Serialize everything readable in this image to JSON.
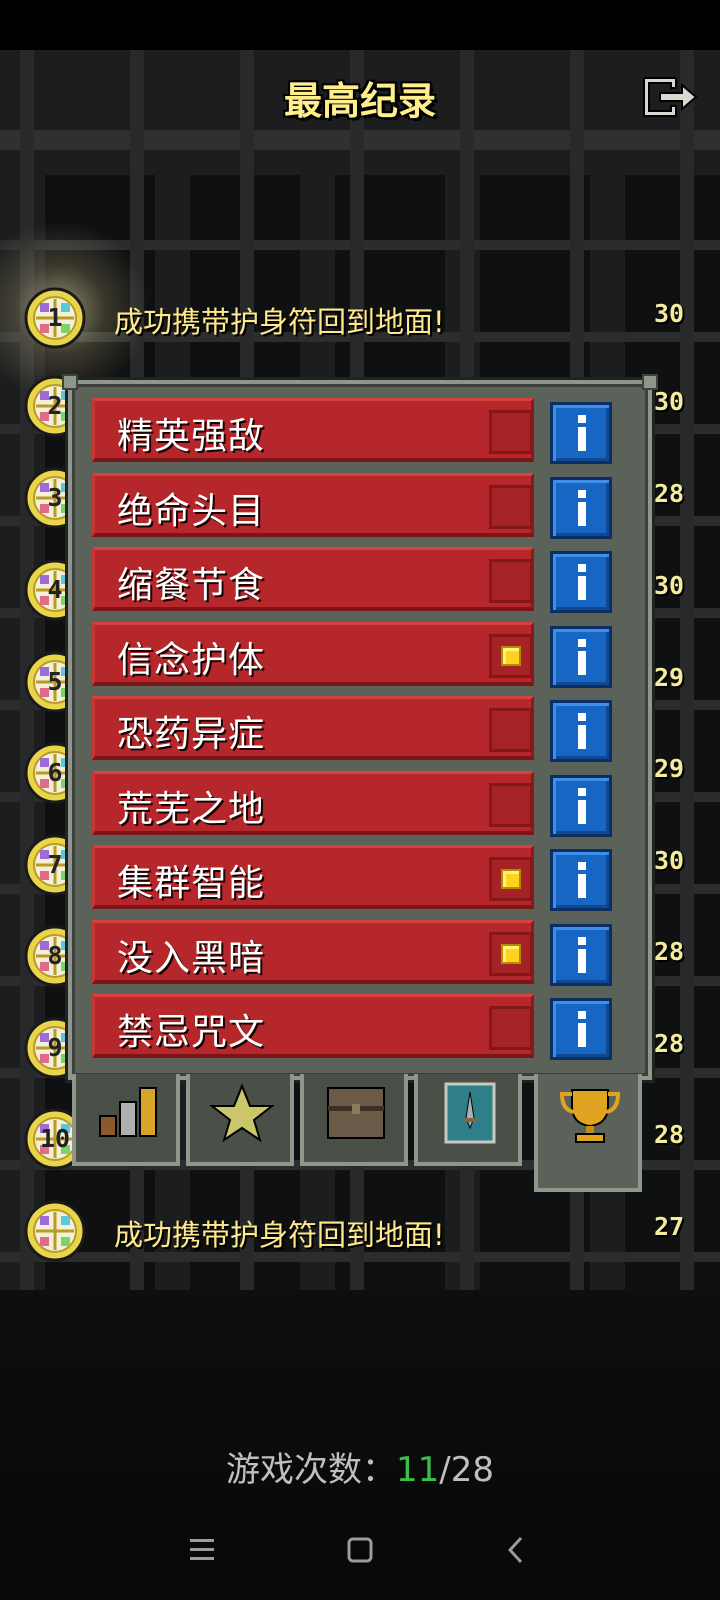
{
  "header": {
    "title": "最高纪录",
    "exit_icon": "exit-door-icon"
  },
  "records": [
    {
      "rank": "1",
      "text": "成功携带护身符回到地面!",
      "depth": "30"
    },
    {
      "rank": "2",
      "text": "",
      "depth": "30"
    },
    {
      "rank": "3",
      "text": "",
      "depth": "28"
    },
    {
      "rank": "4",
      "text": "",
      "depth": "30"
    },
    {
      "rank": "5",
      "text": "",
      "depth": "29"
    },
    {
      "rank": "6",
      "text": "",
      "depth": "29"
    },
    {
      "rank": "7",
      "text": "",
      "depth": "30"
    },
    {
      "rank": "8",
      "text": "",
      "depth": "28"
    },
    {
      "rank": "9",
      "text": "",
      "depth": "28"
    },
    {
      "rank": "10",
      "text": "",
      "depth": "28"
    },
    {
      "rank": "",
      "text": "成功携带护身符回到地面!",
      "depth": "27"
    }
  ],
  "challenges": [
    {
      "label": "精英强敌",
      "enabled": false
    },
    {
      "label": "绝命头目",
      "enabled": false
    },
    {
      "label": "缩餐节食",
      "enabled": false
    },
    {
      "label": "信念护体",
      "enabled": true
    },
    {
      "label": "恐药异症",
      "enabled": false
    },
    {
      "label": "荒芜之地",
      "enabled": false
    },
    {
      "label": "集群智能",
      "enabled": true
    },
    {
      "label": "没入黑暗",
      "enabled": true
    },
    {
      "label": "禁忌咒文",
      "enabled": false
    }
  ],
  "tabs": [
    {
      "icon": "stats-bars-icon",
      "active": false
    },
    {
      "icon": "star-badge-icon",
      "active": false
    },
    {
      "icon": "chest-icon",
      "active": false
    },
    {
      "icon": "sword-banner-icon",
      "active": false
    },
    {
      "icon": "trophy-icon",
      "active": true
    }
  ],
  "footer": {
    "label": "游戏次数：",
    "current": "11",
    "total": "/28"
  },
  "nav": {
    "menu_icon": "menu-icon",
    "home_icon": "home-icon",
    "back_icon": "back-icon"
  },
  "colors": {
    "title": "#ffef8a",
    "challenge_bar": "#b5272b",
    "info_button": "#1766c4",
    "checked": "#ffd21f",
    "games_current": "#3bbf46"
  }
}
